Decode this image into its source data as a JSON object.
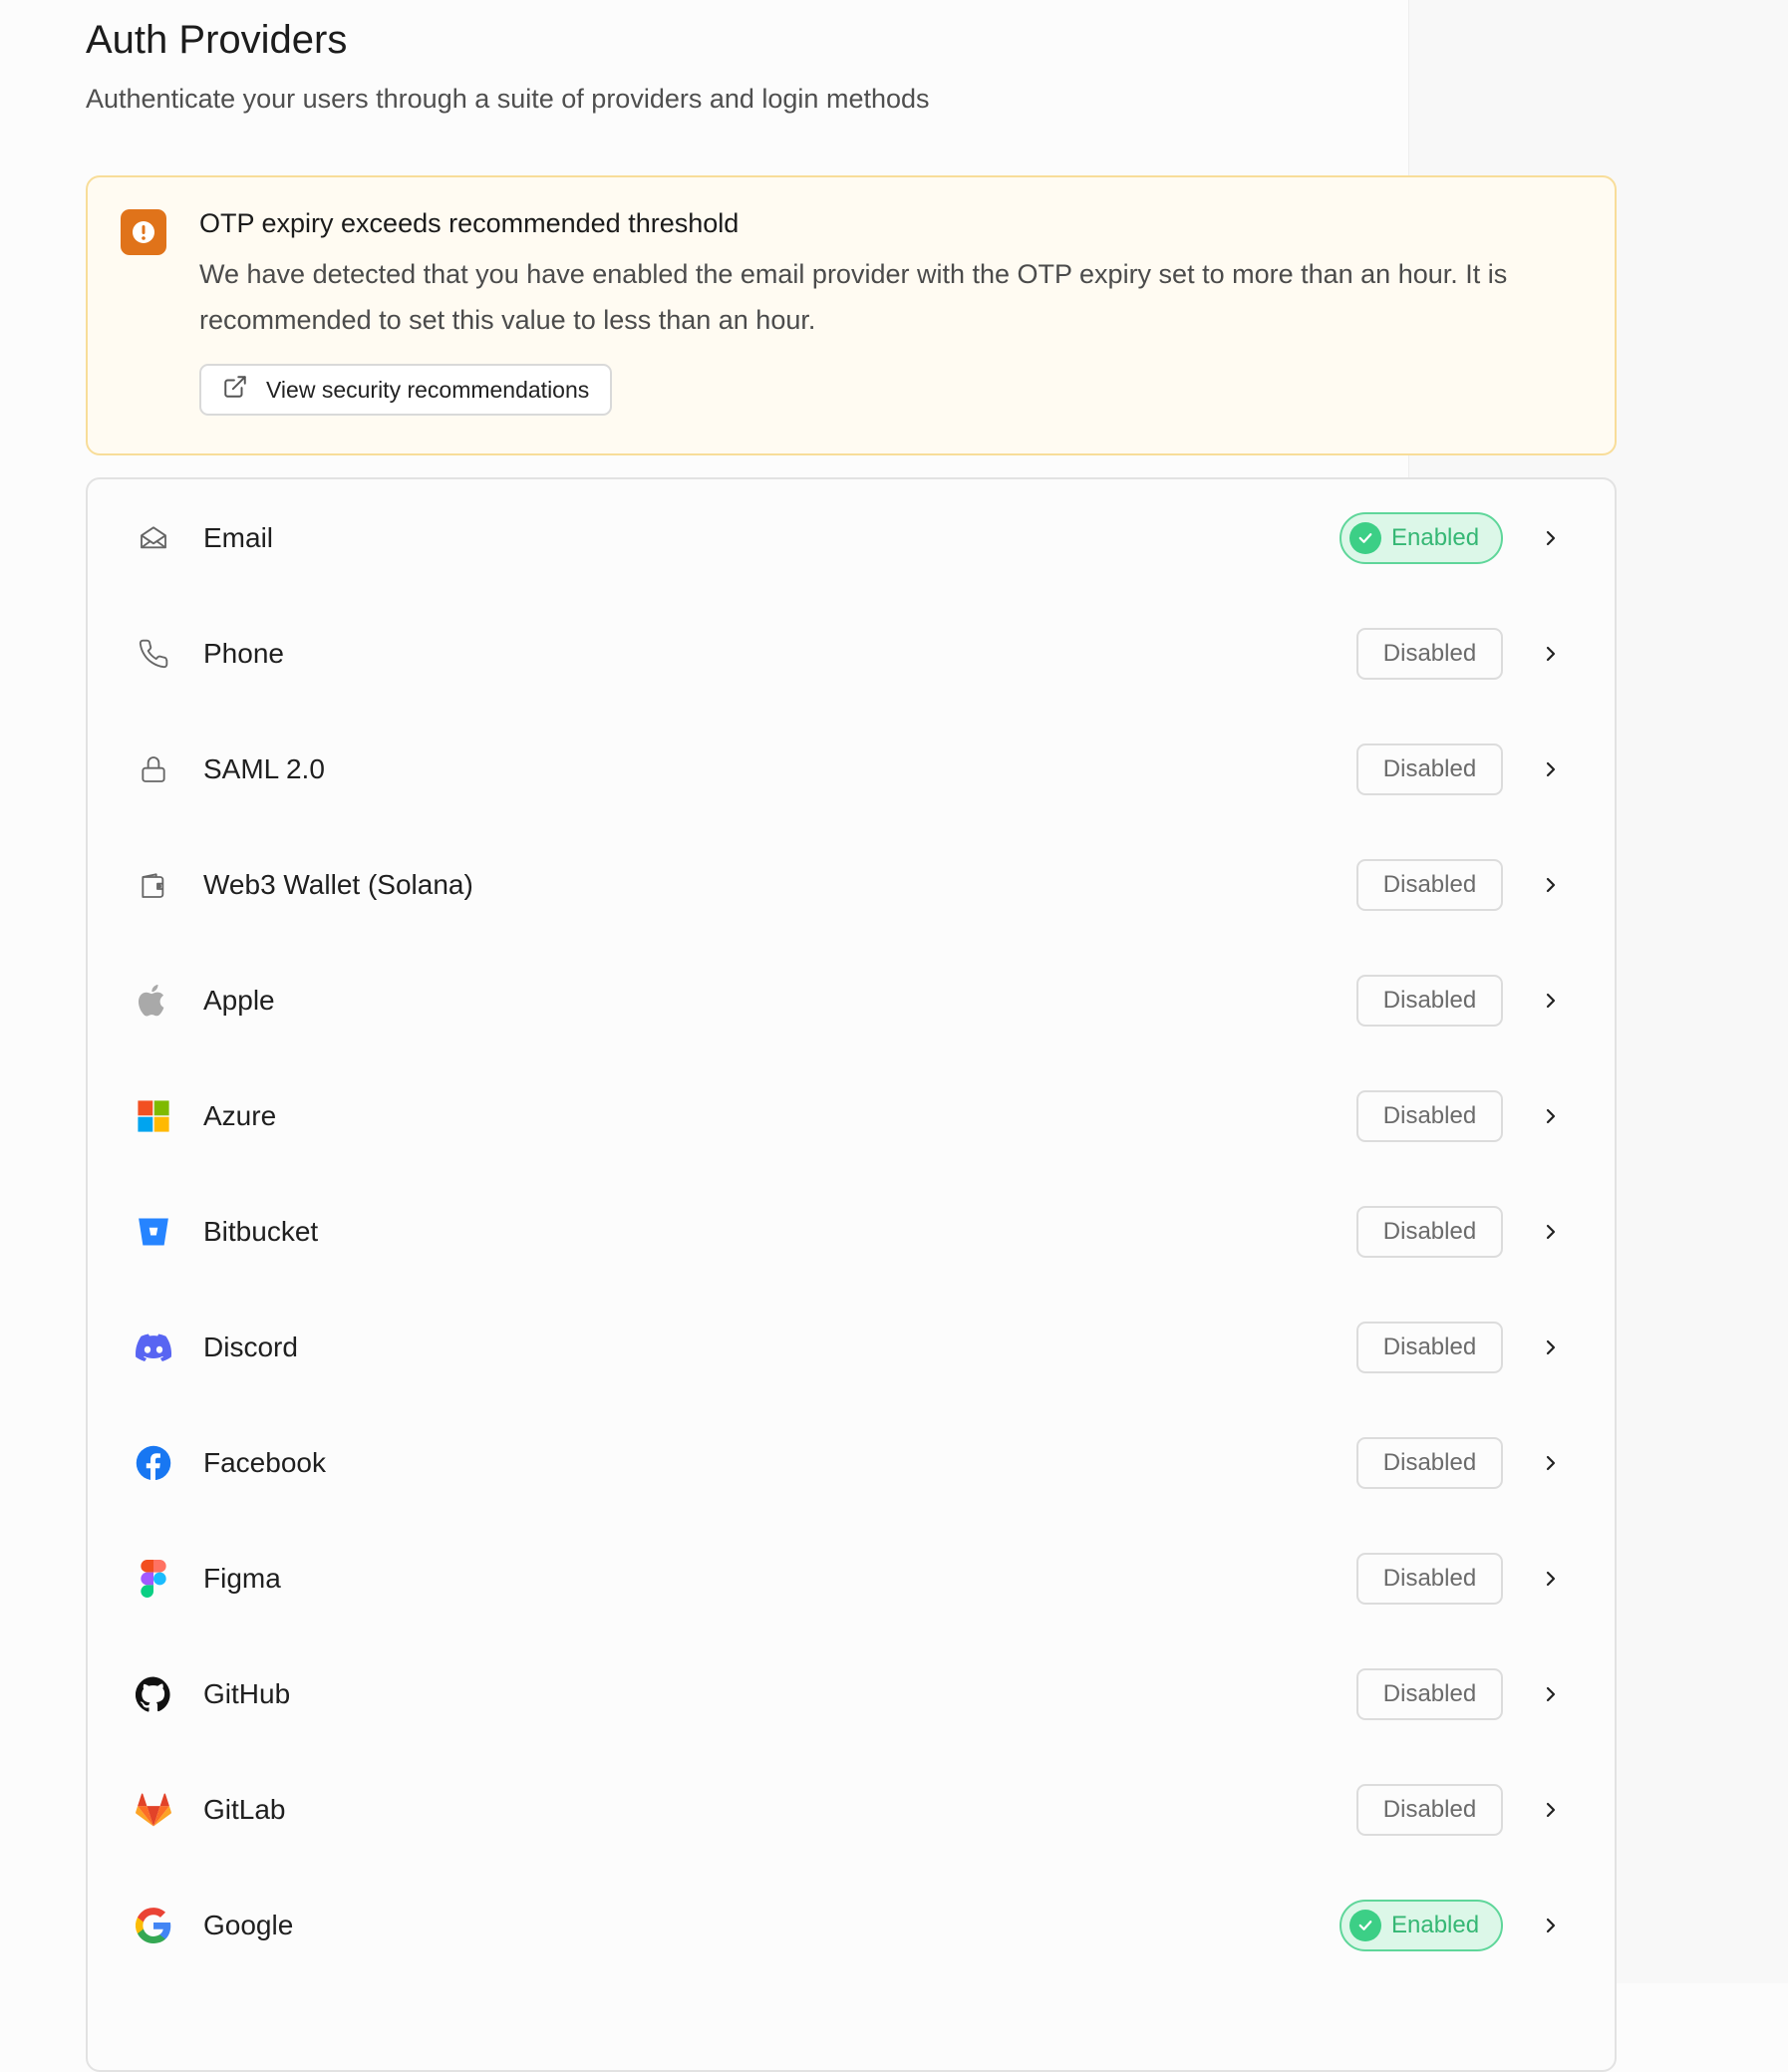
{
  "header": {
    "title": "Auth Providers",
    "subtitle": "Authenticate your users through a suite of providers and login methods"
  },
  "alert": {
    "title": "OTP expiry exceeds recommended threshold",
    "body": "We have detected that you have enabled the email provider with the OTP expiry set to more than an hour. It is recommended to set this value to less than an hour.",
    "button_label": "View security recommendations",
    "icon": "exclamation-icon",
    "accent_color": "#e0731a"
  },
  "status_labels": {
    "enabled": "Enabled",
    "disabled": "Disabled"
  },
  "providers": [
    {
      "name": "Email",
      "icon": "email-icon",
      "status": "Enabled"
    },
    {
      "name": "Phone",
      "icon": "phone-icon",
      "status": "Disabled"
    },
    {
      "name": "SAML 2.0",
      "icon": "lock-icon",
      "status": "Disabled"
    },
    {
      "name": "Web3 Wallet (Solana)",
      "icon": "wallet-icon",
      "status": "Disabled"
    },
    {
      "name": "Apple",
      "icon": "apple-icon",
      "status": "Disabled"
    },
    {
      "name": "Azure",
      "icon": "azure-icon",
      "status": "Disabled"
    },
    {
      "name": "Bitbucket",
      "icon": "bitbucket-icon",
      "status": "Disabled"
    },
    {
      "name": "Discord",
      "icon": "discord-icon",
      "status": "Disabled"
    },
    {
      "name": "Facebook",
      "icon": "facebook-icon",
      "status": "Disabled"
    },
    {
      "name": "Figma",
      "icon": "figma-icon",
      "status": "Disabled"
    },
    {
      "name": "GitHub",
      "icon": "github-icon",
      "status": "Disabled"
    },
    {
      "name": "GitLab",
      "icon": "gitlab-icon",
      "status": "Disabled"
    },
    {
      "name": "Google",
      "icon": "google-icon",
      "status": "Enabled"
    }
  ],
  "colors": {
    "enabled_text": "#35b774",
    "enabled_bg": "#dcf7e8",
    "enabled_border": "#5fd69a",
    "alert_border": "#f8dd99",
    "alert_bg": "#fffbf2"
  }
}
